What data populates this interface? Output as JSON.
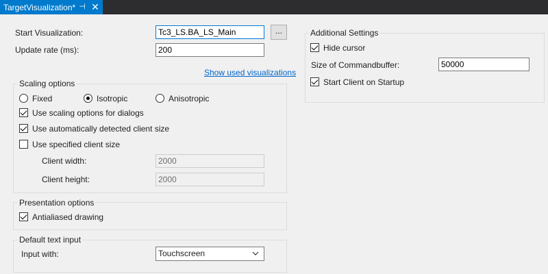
{
  "tab": {
    "title": "TargetVisualization*",
    "pin_glyph": "⊣",
    "close_glyph": "✕"
  },
  "general": {
    "start_visualization_label": "Start Visualization:",
    "start_visualization_value": "Tc3_LS.BA_LS_Main",
    "browse_label": "...",
    "update_rate_label": "Update rate (ms):",
    "update_rate_value": "200",
    "show_used_link": "Show used visualizations"
  },
  "scaling": {
    "title": "Scaling options",
    "radios": [
      {
        "label": "Fixed",
        "checked": false
      },
      {
        "label": "Isotropic",
        "checked": true
      },
      {
        "label": "Anisotropic",
        "checked": false
      }
    ],
    "use_for_dialogs_label": "Use scaling options for dialogs",
    "use_for_dialogs_checked": true,
    "auto_detected_label": "Use automatically detected client size",
    "auto_detected_checked": true,
    "specified_label": "Use specified client size",
    "specified_checked": false,
    "client_width_label": "Client width:",
    "client_width_value": "2000",
    "client_height_label": "Client height:",
    "client_height_value": "2000"
  },
  "presentation": {
    "title": "Presentation options",
    "antialiased_label": "Antialiased drawing",
    "antialiased_checked": true
  },
  "text_input": {
    "title": "Default text input",
    "input_with_label": "Input with:",
    "input_with_value": "Touchscreen"
  },
  "additional": {
    "title": "Additional Settings",
    "hide_cursor_label": "Hide cursor",
    "hide_cursor_checked": true,
    "commandbuffer_label": "Size of Commandbuffer:",
    "commandbuffer_value": "50000",
    "start_client_label": "Start Client on Startup",
    "start_client_checked": true
  },
  "colors": {
    "accent": "#007acc",
    "tabstrip": "#2d2d30",
    "link": "#0066cc",
    "background": "#f0f0f0"
  }
}
